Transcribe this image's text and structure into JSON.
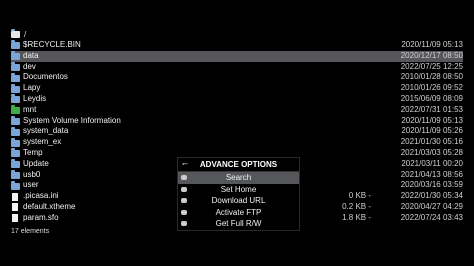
{
  "path": {
    "current": "/"
  },
  "files": [
    {
      "name": "$RECYCLE.BIN",
      "size": "",
      "date": "2020/11/09 05:13",
      "kind": "folder"
    },
    {
      "name": "data",
      "size": "",
      "date": "2020/12/17 08:50",
      "kind": "folder"
    },
    {
      "name": "dev",
      "size": "",
      "date": "2022/07/25 12:25",
      "kind": "folder"
    },
    {
      "name": "Documentos",
      "size": "",
      "date": "2010/01/28 08:50",
      "kind": "folder"
    },
    {
      "name": "Lapy",
      "size": "",
      "date": "2010/01/26 09:52",
      "kind": "folder"
    },
    {
      "name": "Leydis",
      "size": "",
      "date": "2015/06/09 08:09",
      "kind": "folder"
    },
    {
      "name": "mnt",
      "size": "",
      "date": "2022/07/31 01:53",
      "kind": "folder-green"
    },
    {
      "name": "System Volume Information",
      "size": "",
      "date": "2020/11/09 05:13",
      "kind": "folder"
    },
    {
      "name": "system_data",
      "size": "",
      "date": "2020/11/09 05:26",
      "kind": "folder"
    },
    {
      "name": "system_ex",
      "size": "",
      "date": "2021/01/30 05:16",
      "kind": "folder"
    },
    {
      "name": "Temp",
      "size": "",
      "date": "2021/03/03 05:28",
      "kind": "folder"
    },
    {
      "name": "Update",
      "size": "",
      "date": "2021/03/11 00:20",
      "kind": "folder"
    },
    {
      "name": "usb0",
      "size": "",
      "date": "2021/04/13 08:56",
      "kind": "folder"
    },
    {
      "name": "user",
      "size": "",
      "date": "2020/03/16 03:59",
      "kind": "folder"
    },
    {
      "name": ".picasa.ini",
      "size": "0 KB",
      "date": "2022/01/30 05:34",
      "kind": "file"
    },
    {
      "name": "default.xtheme",
      "size": "0.2 KB",
      "date": "2020/04/27 04:29",
      "kind": "file"
    },
    {
      "name": "param.sfo",
      "size": "1.8 KB",
      "date": "2022/07/24 03:43",
      "kind": "file"
    }
  ],
  "selected_index": 1,
  "footer": {
    "count": "17 elements"
  },
  "menu": {
    "title": "ADVANCE OPTIONS",
    "back_icon": "↽",
    "items": [
      {
        "label": "Search",
        "active": true,
        "icon": "search-icon"
      },
      {
        "label": "Set Home",
        "active": false,
        "icon": "home-icon"
      },
      {
        "label": "Download URL",
        "active": false,
        "icon": "cloud-download-icon"
      },
      {
        "label": "Activate FTP",
        "active": false,
        "icon": "ftp-icon"
      },
      {
        "label": "Get Full R/W",
        "active": false,
        "icon": "key-icon"
      }
    ]
  },
  "colors": {
    "folder": "#7aa5d6",
    "folder_green": "#3fae4a",
    "selection": "#55575b"
  }
}
